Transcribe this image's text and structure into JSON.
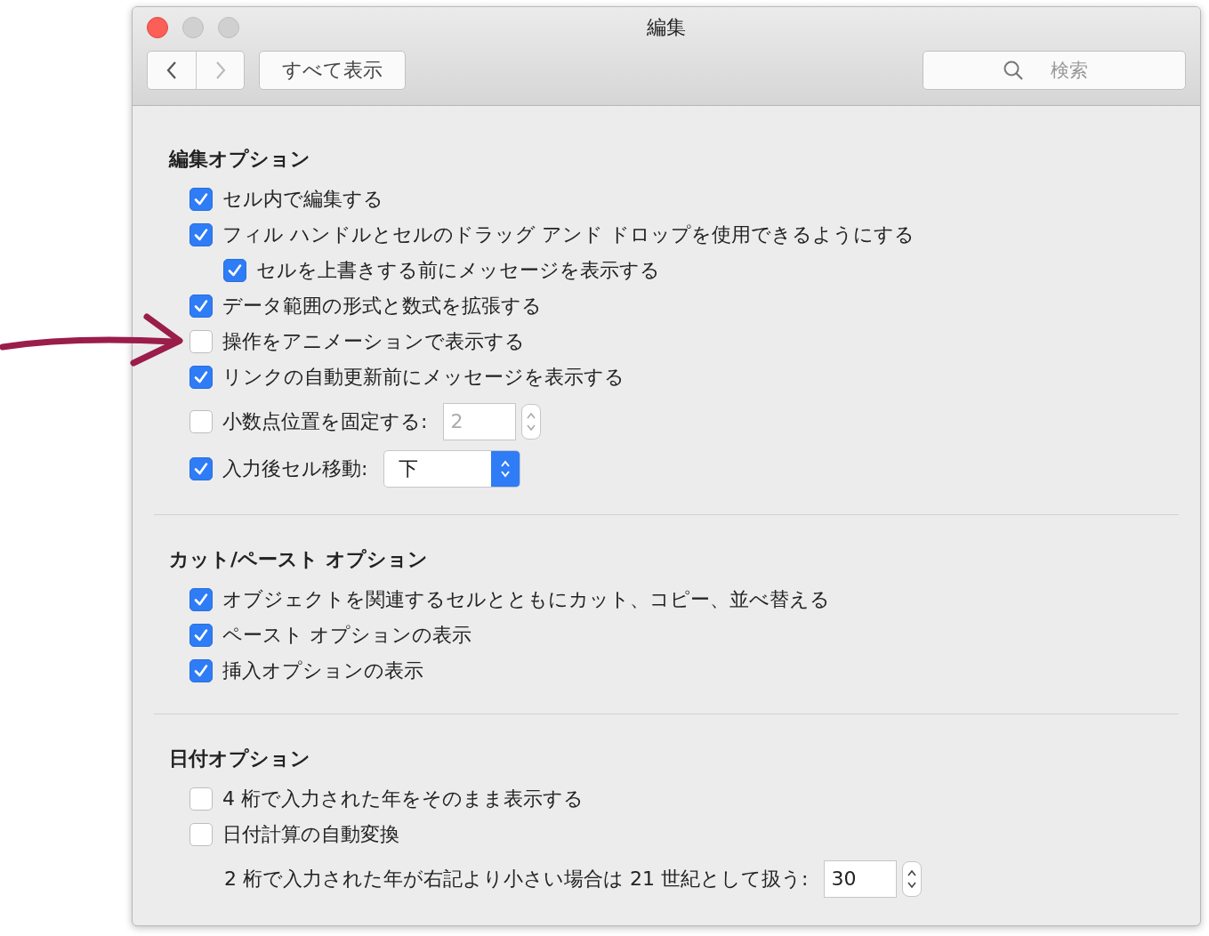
{
  "window": {
    "title": "編集"
  },
  "toolbar": {
    "show_all": "すべて表示",
    "search": {
      "placeholder": "検索"
    }
  },
  "sections": [
    {
      "title": "編集オプション",
      "options": [
        {
          "kind": "checkbox",
          "label": "セル内で編集する",
          "checked": true
        },
        {
          "kind": "checkbox",
          "label": "フィル ハンドルとセルのドラッグ アンド ドロップを使用できるようにする",
          "checked": true,
          "children": [
            {
              "kind": "checkbox",
              "label": "セルを上書きする前にメッセージを表示する",
              "checked": true
            }
          ]
        },
        {
          "kind": "checkbox",
          "label": "データ範囲の形式と数式を拡張する",
          "checked": true
        },
        {
          "kind": "checkbox",
          "label": "操作をアニメーションで表示する",
          "checked": false
        },
        {
          "kind": "checkbox",
          "label": "リンクの自動更新前にメッセージを表示する",
          "checked": true
        },
        {
          "kind": "checkbox_stepper",
          "label": "小数点位置を固定する:",
          "checked": false,
          "value": "2",
          "disabled": true
        },
        {
          "kind": "checkbox_select",
          "label": "入力後セル移動:",
          "checked": true,
          "value": "下"
        }
      ]
    },
    {
      "title": "カット/ペースト オプション",
      "options": [
        {
          "kind": "checkbox",
          "label": "オブジェクトを関連するセルとともにカット、コピー、並べ替える",
          "checked": true
        },
        {
          "kind": "checkbox",
          "label": "ペースト オプションの表示",
          "checked": true
        },
        {
          "kind": "checkbox",
          "label": "挿入オプションの表示",
          "checked": true
        }
      ]
    },
    {
      "title": "日付オプション",
      "options": [
        {
          "kind": "checkbox",
          "label": "4 桁で入力された年をそのまま表示する",
          "checked": false
        },
        {
          "kind": "checkbox",
          "label": "日付計算の自動変換",
          "checked": false
        },
        {
          "kind": "stepper",
          "label": "2 桁で入力された年が右記より小さい場合は 21 世紀として扱う:",
          "value": "30",
          "disabled": false
        }
      ]
    }
  ]
}
